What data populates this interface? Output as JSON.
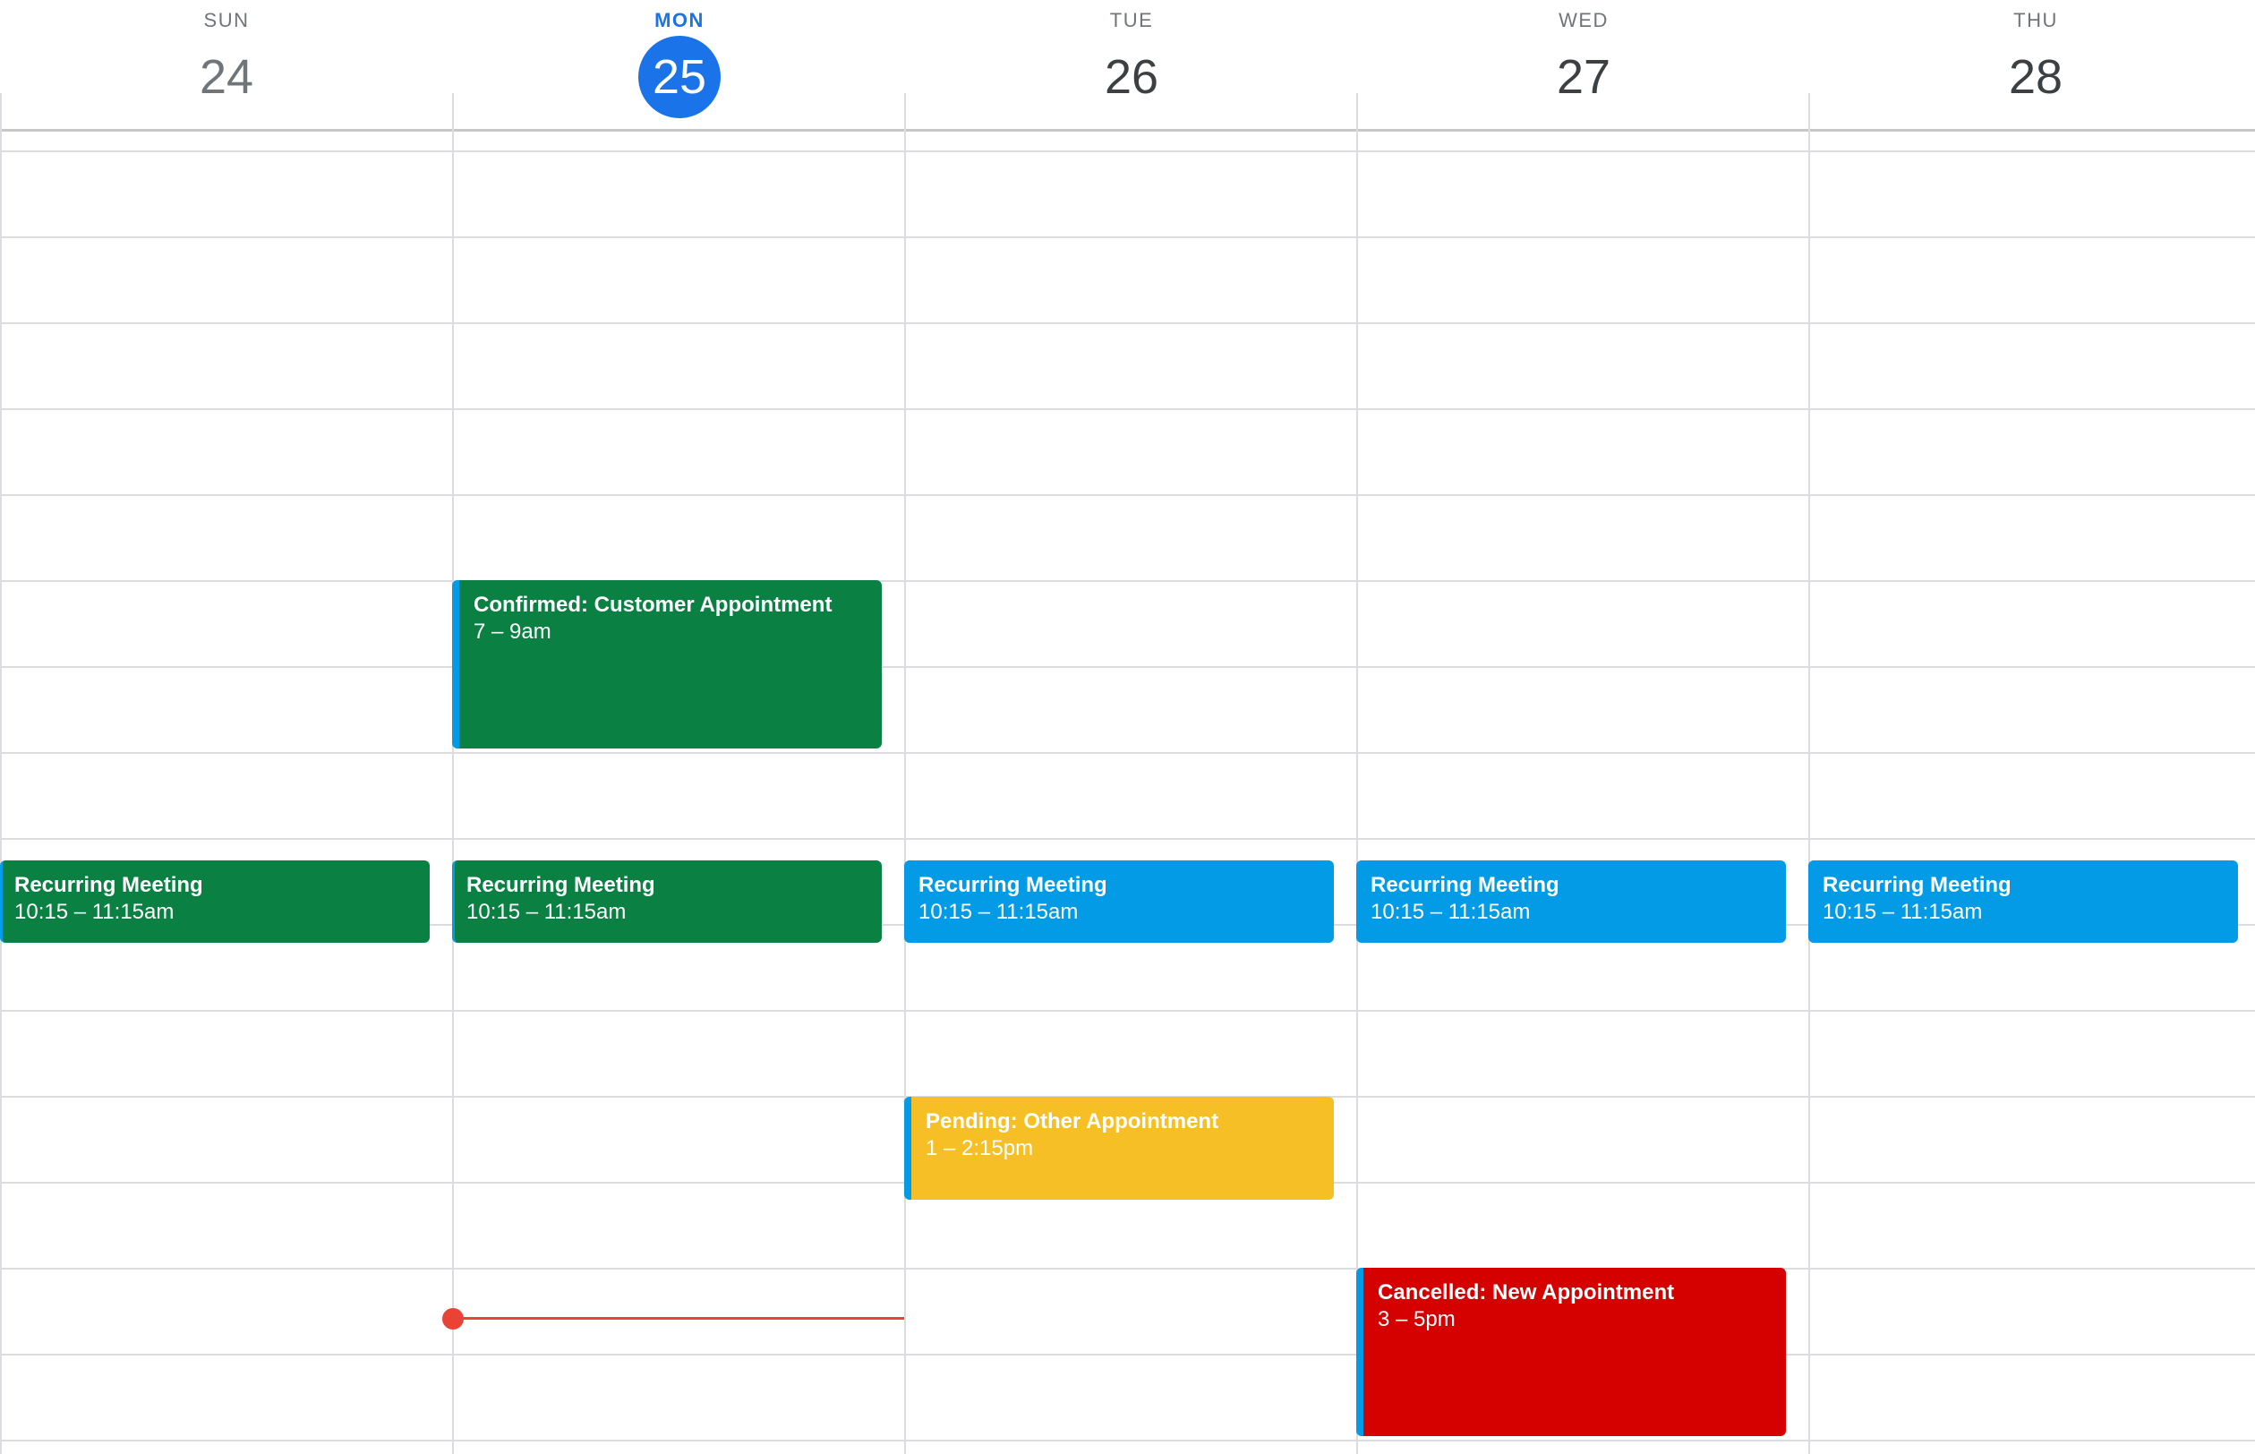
{
  "days": [
    {
      "dow": "SUN",
      "date": "24"
    },
    {
      "dow": "MON",
      "date": "25",
      "today": true
    },
    {
      "dow": "TUE",
      "date": "26"
    },
    {
      "dow": "WED",
      "date": "27"
    },
    {
      "dow": "THU",
      "date": "28"
    }
  ],
  "events": {
    "mon_confirmed": {
      "title": "Confirmed: Customer Appointment",
      "time": "7 – 9am"
    },
    "sun_recurring": {
      "title": "Recurring Meeting",
      "time": "10:15 – 11:15am"
    },
    "mon_recurring": {
      "title": "Recurring Meeting",
      "time": "10:15 – 11:15am"
    },
    "tue_recurring": {
      "title": "Recurring Meeting",
      "time": "10:15 – 11:15am"
    },
    "wed_recurring": {
      "title": "Recurring Meeting",
      "time": "10:15 – 11:15am"
    },
    "thu_recurring": {
      "title": "Recurring Meeting",
      "time": "10:15 – 11:15am"
    },
    "tue_pending": {
      "title": "Pending: Other Appointment",
      "time": "1 – 2:15pm"
    },
    "wed_cancelled": {
      "title": "Cancelled: New Appointment",
      "time": "3 – 5pm"
    }
  },
  "colors": {
    "today_blue": "#1a73e8",
    "confirmed_green": "#0b8043",
    "peacock_blue": "#039be5",
    "pending_yellow": "#f6bf26",
    "cancelled_red": "#d50000",
    "now_indicator": "#ea4335",
    "gridline": "#dadce0"
  }
}
